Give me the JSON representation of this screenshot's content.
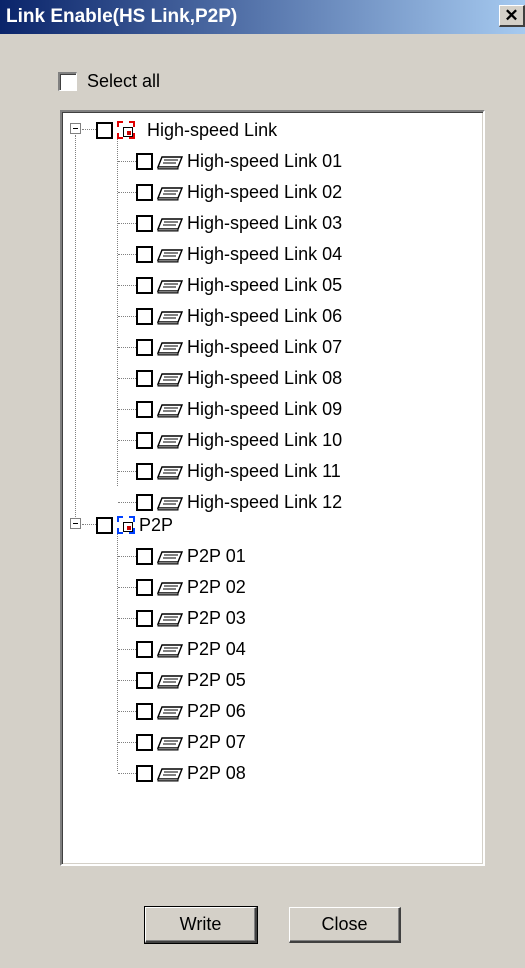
{
  "window": {
    "title": "Link Enable(HS Link,P2P)",
    "close_glyph": "✕"
  },
  "select_all": {
    "label": "Select all",
    "checked": false
  },
  "tree": {
    "groups": [
      {
        "label": "High-speed Link",
        "icon": "hs-link-group-icon",
        "expanded": true,
        "checked": false,
        "items": [
          "High-speed Link 01",
          "High-speed Link 02",
          "High-speed Link 03",
          "High-speed Link 04",
          "High-speed Link 05",
          "High-speed Link 06",
          "High-speed Link 07",
          "High-speed Link 08",
          "High-speed Link 09",
          "High-speed Link 10",
          "High-speed Link 11",
          "High-speed Link 12"
        ]
      },
      {
        "label": "P2P",
        "icon": "p2p-group-icon",
        "expanded": true,
        "checked": false,
        "items": [
          "P2P 01",
          "P2P 02",
          "P2P 03",
          "P2P 04",
          "P2P 05",
          "P2P 06",
          "P2P 07",
          "P2P 08"
        ]
      }
    ]
  },
  "buttons": {
    "write_label": "Write",
    "close_label": "Close"
  },
  "colors": {
    "titlebar_start": "#0a246a",
    "titlebar_end": "#a6caf0",
    "face": "#d4d0c8",
    "hs_group_accent": "#e00000",
    "p2p_group_accent": "#0040ff"
  }
}
